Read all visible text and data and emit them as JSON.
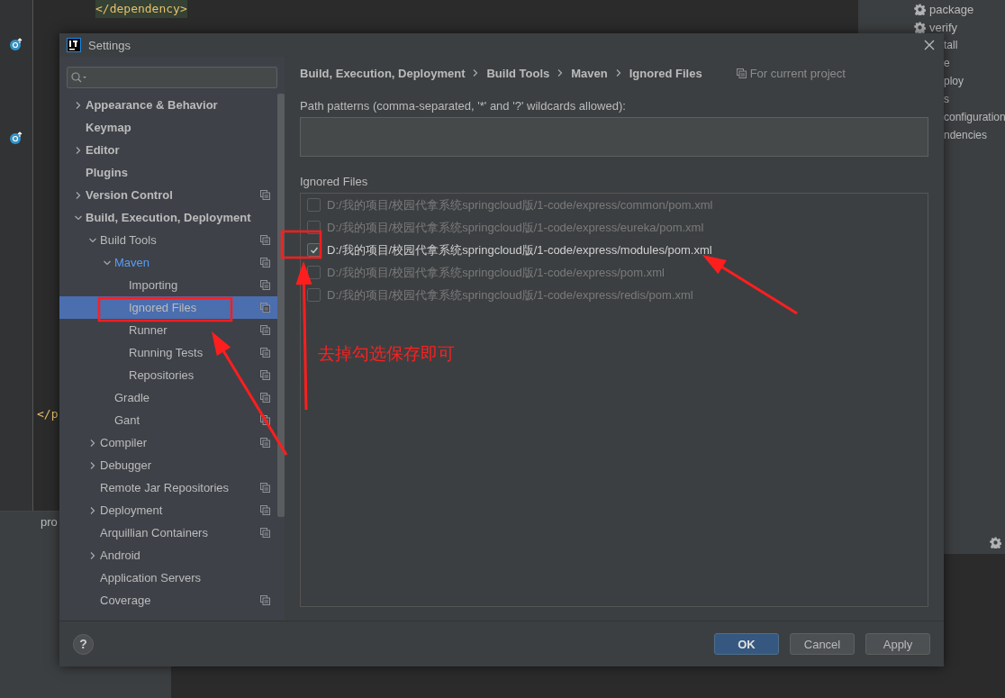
{
  "editor": {
    "code_lines": [
      {
        "text": "</dependency>"
      },
      {
        "text": "</p"
      }
    ],
    "tab": "pro"
  },
  "maven_panel": {
    "items": [
      {
        "label": "package"
      },
      {
        "label": "verify"
      }
    ],
    "cut_items": [
      "tall",
      "e",
      "ploy",
      "s",
      "configuration",
      "ndencies"
    ]
  },
  "dialog": {
    "title": "Settings",
    "tree": [
      {
        "label": "Appearance & Behavior",
        "kind": "folder",
        "expanded": false,
        "selected": false,
        "modified": false,
        "project_level": false
      },
      {
        "label": "Keymap",
        "kind": "page",
        "selected": false,
        "modified": false,
        "project_level": false
      },
      {
        "label": "Editor",
        "kind": "folder",
        "expanded": false,
        "selected": false,
        "modified": false,
        "project_level": false
      },
      {
        "label": "Plugins",
        "kind": "page",
        "selected": false,
        "modified": false,
        "project_level": false
      },
      {
        "label": "Version Control",
        "kind": "folder",
        "expanded": false,
        "selected": false,
        "modified": false,
        "project_level": true
      },
      {
        "label": "Build, Execution, Deployment",
        "kind": "folder",
        "expanded": true,
        "selected": false,
        "modified": false,
        "project_level": false,
        "children": [
          {
            "label": "Build Tools",
            "kind": "folder",
            "expanded": true,
            "selected": false,
            "modified": false,
            "project_level": true,
            "children": [
              {
                "label": "Maven",
                "kind": "folder",
                "expanded": true,
                "selected": false,
                "modified": true,
                "project_level": true,
                "children": [
                  {
                    "label": "Importing",
                    "kind": "page",
                    "selected": false,
                    "modified": false,
                    "project_level": true
                  },
                  {
                    "label": "Ignored Files",
                    "kind": "page",
                    "selected": true,
                    "modified": false,
                    "project_level": true
                  },
                  {
                    "label": "Runner",
                    "kind": "page",
                    "selected": false,
                    "modified": false,
                    "project_level": true
                  },
                  {
                    "label": "Running Tests",
                    "kind": "page",
                    "selected": false,
                    "modified": false,
                    "project_level": true
                  },
                  {
                    "label": "Repositories",
                    "kind": "page",
                    "selected": false,
                    "modified": false,
                    "project_level": true
                  }
                ]
              },
              {
                "label": "Gradle",
                "kind": "page",
                "selected": false,
                "modified": false,
                "project_level": true
              },
              {
                "label": "Gant",
                "kind": "page",
                "selected": false,
                "modified": false,
                "project_level": true
              }
            ]
          },
          {
            "label": "Compiler",
            "kind": "folder",
            "expanded": false,
            "selected": false,
            "modified": false,
            "project_level": true
          },
          {
            "label": "Debugger",
            "kind": "folder",
            "expanded": false,
            "selected": false,
            "modified": false,
            "project_level": false
          },
          {
            "label": "Remote Jar Repositories",
            "kind": "page",
            "selected": false,
            "modified": false,
            "project_level": true
          },
          {
            "label": "Deployment",
            "kind": "folder",
            "expanded": false,
            "selected": false,
            "modified": false,
            "project_level": true
          },
          {
            "label": "Arquillian Containers",
            "kind": "page",
            "selected": false,
            "modified": false,
            "project_level": true
          },
          {
            "label": "Android",
            "kind": "folder",
            "expanded": false,
            "selected": false,
            "modified": false,
            "project_level": false
          },
          {
            "label": "Application Servers",
            "kind": "page",
            "selected": false,
            "modified": false,
            "project_level": false
          },
          {
            "label": "Coverage",
            "kind": "page",
            "selected": false,
            "modified": false,
            "project_level": true
          }
        ]
      }
    ],
    "breadcrumb": [
      "Build, Execution, Deployment",
      "Build Tools",
      "Maven",
      "Ignored Files"
    ],
    "scope": "For current project",
    "path_patterns_label": "Path patterns (comma-separated, '*' and '?' wildcards allowed):",
    "ignored_files_label": "Ignored Files",
    "files": [
      {
        "path": "D:/我的项目/校园代拿系统springcloud版/1-code/express/common/pom.xml",
        "checked": false
      },
      {
        "path": "D:/我的项目/校园代拿系统springcloud版/1-code/express/eureka/pom.xml",
        "checked": false
      },
      {
        "path": "D:/我的项目/校园代拿系统springcloud版/1-code/express/modules/pom.xml",
        "checked": true
      },
      {
        "path": "D:/我的项目/校园代拿系统springcloud版/1-code/express/pom.xml",
        "checked": false
      },
      {
        "path": "D:/我的项目/校园代拿系统springcloud版/1-code/express/redis/pom.xml",
        "checked": false
      }
    ],
    "help": "?",
    "buttons": [
      {
        "label": "OK",
        "kind": "primary"
      },
      {
        "label": "Cancel",
        "kind": "normal"
      },
      {
        "label": "Apply",
        "kind": "normal"
      }
    ]
  },
  "annotation": {
    "note": "去掉勾选保存即可"
  }
}
